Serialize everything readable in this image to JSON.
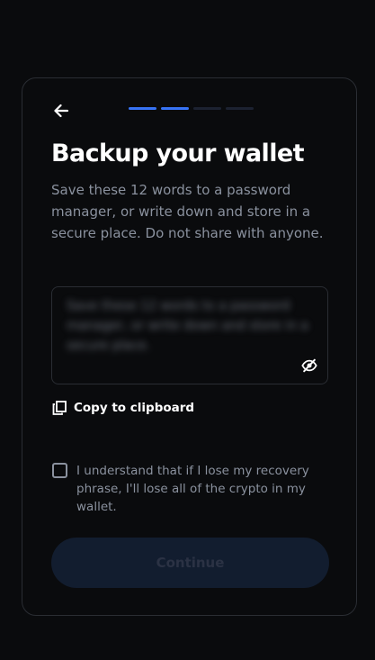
{
  "header": {
    "back_icon": "arrow-left-icon",
    "progress_steps": [
      {
        "state": "active"
      },
      {
        "state": "active"
      },
      {
        "state": "inactive"
      },
      {
        "state": "inactive"
      }
    ]
  },
  "title": "Backup your wallet",
  "subtitle": "Save these 12 words to a password manager, or write down and store in a secure place. Do not share with anyone.",
  "phrase_box": {
    "hidden_text": "Save these 12 words to a password manager, or write down and store in a secure place.",
    "toggle_icon": "eye-off-icon"
  },
  "copy": {
    "icon": "copy-icon",
    "label": "Copy to clipboard"
  },
  "acknowledgement": {
    "checked": false,
    "label": "I understand that if I lose my recovery phrase, I'll lose all of the crypto in my wallet."
  },
  "continue": {
    "label": "Continue",
    "enabled": false
  },
  "colors": {
    "background": "#0a0b0d",
    "accent": "#3773f5",
    "muted_text": "#8a919e",
    "border": "#2a2d33",
    "button_disabled_bg": "#121d2f"
  }
}
